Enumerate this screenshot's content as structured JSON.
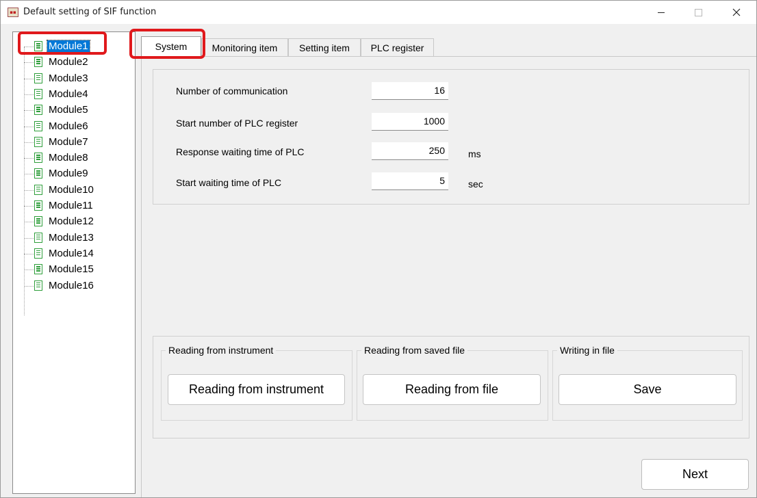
{
  "window": {
    "app_icon": "app-logo-icon",
    "title": "Default setting of SIF function",
    "controls": [
      "minimize-icon",
      "maximize-icon",
      "close-icon"
    ]
  },
  "tree": {
    "item_icon": "document-icon",
    "selected_index": 0,
    "items": [
      {
        "label": "Module1"
      },
      {
        "label": "Module2"
      },
      {
        "label": "Module3"
      },
      {
        "label": "Module4"
      },
      {
        "label": "Module5"
      },
      {
        "label": "Module6"
      },
      {
        "label": "Module7"
      },
      {
        "label": "Module8"
      },
      {
        "label": "Module9"
      },
      {
        "label": "Module10"
      },
      {
        "label": "Module11"
      },
      {
        "label": "Module12"
      },
      {
        "label": "Module13"
      },
      {
        "label": "Module14"
      },
      {
        "label": "Module15"
      },
      {
        "label": "Module16"
      }
    ]
  },
  "tabs": [
    {
      "label": "System",
      "active": true
    },
    {
      "label": "Monitoring item",
      "active": false
    },
    {
      "label": "Setting item",
      "active": false
    },
    {
      "label": "PLC register",
      "active": false
    }
  ],
  "system": {
    "fields": [
      {
        "label": "Number of communication",
        "value": "16",
        "unit": ""
      },
      {
        "label": "Start number of PLC register",
        "value": "1000",
        "unit": ""
      },
      {
        "label": "Response waiting time of PLC",
        "value": "250",
        "unit": "ms"
      },
      {
        "label": "Start waiting time of PLC",
        "value": "5",
        "unit": "sec"
      }
    ]
  },
  "operations": {
    "instrument": {
      "legend": "Reading from instrument",
      "button": "Reading from instrument"
    },
    "saved_file": {
      "legend": "Reading from saved file",
      "button": "Reading from file"
    },
    "write_file": {
      "legend": "Writing in file",
      "button": "Save"
    }
  },
  "footer": {
    "next_label": "Next"
  },
  "colors": {
    "highlight_red": "#e0191c",
    "selection_blue": "#0078d7",
    "doc_icon_green": "#2e9e3a",
    "dialog_bg": "#f0f0f0"
  }
}
